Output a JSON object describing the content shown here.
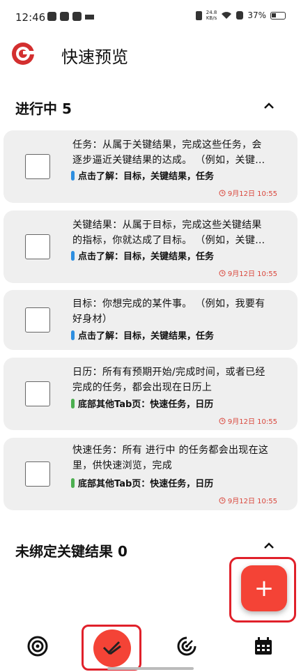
{
  "status_bar": {
    "time": "12:46",
    "speed_value": "24.8",
    "speed_unit": "KB/s",
    "battery": "37%"
  },
  "header": {
    "title": "快速预览",
    "logo_icon": "target-logo-icon"
  },
  "sections": {
    "in_progress": {
      "title": "进行中 5"
    },
    "unbound": {
      "title": "未绑定关键结果 0"
    }
  },
  "cards": [
    {
      "line1": "任务：从属于关键结果，完成这些任务，会",
      "line2": "逐步逼近关键结果的达成。 （例如，关键…",
      "tag": "点击了解：目标，关键结果，任务",
      "tag_color": "#2f8fe0",
      "time": "9月12日 10:55"
    },
    {
      "line1": "关键结果：从属于目标，完成这些关键结果",
      "line2": "的指标，你就达成了目标。 （例如，关键…",
      "tag": "点击了解：目标，关键结果，任务",
      "tag_color": "#2f8fe0",
      "time": "9月12日 10:55"
    },
    {
      "line1": "目标：你想完成的某件事。 （例如，我要有",
      "line2": "好身材）",
      "tag": "点击了解：目标，关键结果，任务",
      "tag_color": "#2f8fe0",
      "time": ""
    },
    {
      "line1": "日历：所有有预期开始/完成时间，或者已经",
      "line2": "完成的任务，都会出现在日历上",
      "tag": "底部其他Tab页：快速任务，日历",
      "tag_color": "#4caf50",
      "time": "9月12日 10:55"
    },
    {
      "line1": "快速任务：所有 进行中 的任务都会出现在这",
      "line2": "里，供快速浏览，完成",
      "tag": "底部其他Tab页：快速任务，日历",
      "tag_color": "#4caf50",
      "time": "9月12日 10:55"
    }
  ],
  "fab": {
    "label": "+"
  },
  "colors": {
    "accent": "#f44336",
    "highlight": "#e0202a",
    "time_red": "#d9453a"
  }
}
